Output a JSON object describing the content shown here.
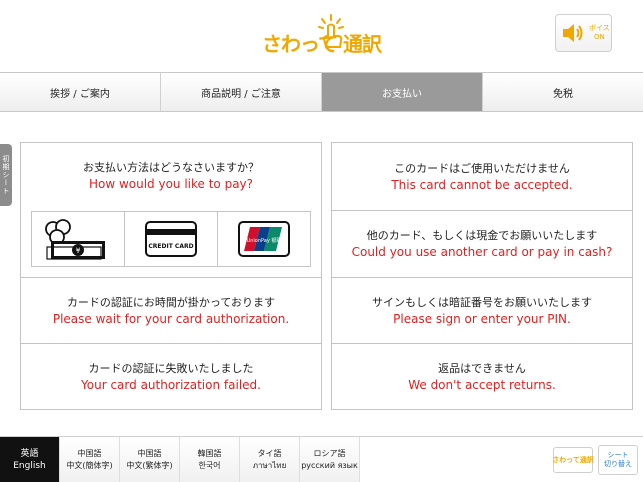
{
  "header": {
    "logo_text": "さわって 通訳",
    "voice_label": "ボイス\nON"
  },
  "tabs": [
    {
      "label": "挨拶 / ご案内"
    },
    {
      "label": "商品説明 / ご注意"
    },
    {
      "label": "お支払い"
    },
    {
      "label": "免税"
    }
  ],
  "side_tab": {
    "label": "初期シート"
  },
  "left_panel": {
    "q_jp": "お支払い方法はどうなさいますか？",
    "q_en": "How would you like to pay?",
    "credit_card_label": "CREDIT CARD",
    "unionpay_label": "UnionPay 银联",
    "auth_wait_jp": "カードの認証にお時間が掛かっております",
    "auth_wait_en": "Please wait for your card authorization.",
    "auth_fail_jp": "カードの認証に失敗いたしました",
    "auth_fail_en": "Your card authorization failed."
  },
  "right_panel": {
    "not_accepted_jp": "このカードはご使用いただけません",
    "not_accepted_en": "This card cannot be accepted.",
    "another_jp": "他のカード、もしくは現金でお願いいたします",
    "another_en": "Could you use another card or pay in cash?",
    "sign_jp": "サインもしくは暗証番号をお願いいたします",
    "sign_en": "Please sign or enter your PIN.",
    "returns_jp": "返品はできません",
    "returns_en": "We don't accept returns."
  },
  "languages": [
    {
      "l1": "英語",
      "l2": "English"
    },
    {
      "l1": "中国語",
      "l2": "中文(簡体字)"
    },
    {
      "l1": "中国語",
      "l2": "中文(繁体字)"
    },
    {
      "l1": "韓国語",
      "l2": "한국어"
    },
    {
      "l1": "タイ語",
      "l2": "ภาษาไทย"
    },
    {
      "l1": "ロシア語",
      "l2": "русский язык"
    }
  ],
  "bottom": {
    "logo_text": "さわって通訳",
    "sheet_label": "シート\n切り替え"
  },
  "colors": {
    "accent": "#f0a800",
    "english_text": "#e02020",
    "active_tab": "#9a9a9a",
    "link_blue": "#2a7bd0"
  }
}
